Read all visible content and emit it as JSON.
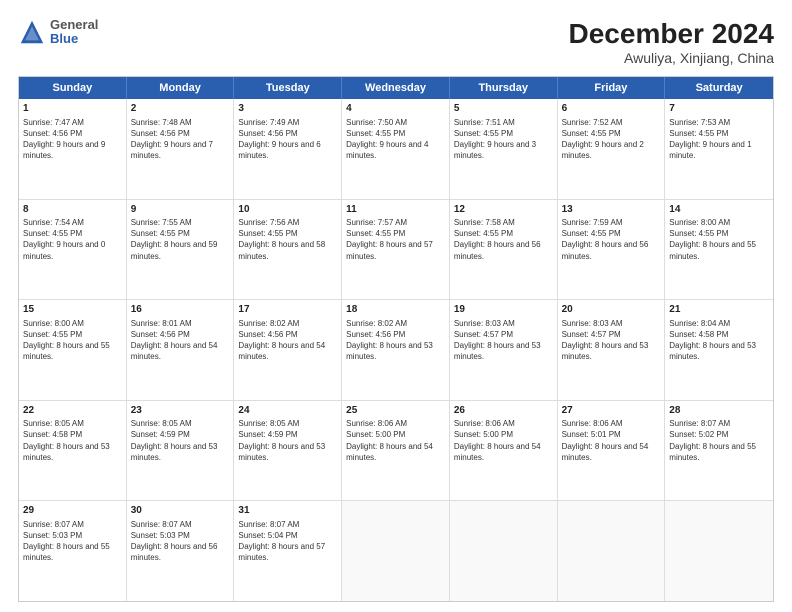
{
  "header": {
    "logo_general": "General",
    "logo_blue": "Blue",
    "title": "December 2024",
    "subtitle": "Awuliya, Xinjiang, China"
  },
  "weekdays": [
    "Sunday",
    "Monday",
    "Tuesday",
    "Wednesday",
    "Thursday",
    "Friday",
    "Saturday"
  ],
  "weeks": [
    [
      {
        "day": "1",
        "sunrise": "Sunrise: 7:47 AM",
        "sunset": "Sunset: 4:56 PM",
        "daylight": "Daylight: 9 hours and 9 minutes."
      },
      {
        "day": "2",
        "sunrise": "Sunrise: 7:48 AM",
        "sunset": "Sunset: 4:56 PM",
        "daylight": "Daylight: 9 hours and 7 minutes."
      },
      {
        "day": "3",
        "sunrise": "Sunrise: 7:49 AM",
        "sunset": "Sunset: 4:56 PM",
        "daylight": "Daylight: 9 hours and 6 minutes."
      },
      {
        "day": "4",
        "sunrise": "Sunrise: 7:50 AM",
        "sunset": "Sunset: 4:55 PM",
        "daylight": "Daylight: 9 hours and 4 minutes."
      },
      {
        "day": "5",
        "sunrise": "Sunrise: 7:51 AM",
        "sunset": "Sunset: 4:55 PM",
        "daylight": "Daylight: 9 hours and 3 minutes."
      },
      {
        "day": "6",
        "sunrise": "Sunrise: 7:52 AM",
        "sunset": "Sunset: 4:55 PM",
        "daylight": "Daylight: 9 hours and 2 minutes."
      },
      {
        "day": "7",
        "sunrise": "Sunrise: 7:53 AM",
        "sunset": "Sunset: 4:55 PM",
        "daylight": "Daylight: 9 hours and 1 minute."
      }
    ],
    [
      {
        "day": "8",
        "sunrise": "Sunrise: 7:54 AM",
        "sunset": "Sunset: 4:55 PM",
        "daylight": "Daylight: 9 hours and 0 minutes."
      },
      {
        "day": "9",
        "sunrise": "Sunrise: 7:55 AM",
        "sunset": "Sunset: 4:55 PM",
        "daylight": "Daylight: 8 hours and 59 minutes."
      },
      {
        "day": "10",
        "sunrise": "Sunrise: 7:56 AM",
        "sunset": "Sunset: 4:55 PM",
        "daylight": "Daylight: 8 hours and 58 minutes."
      },
      {
        "day": "11",
        "sunrise": "Sunrise: 7:57 AM",
        "sunset": "Sunset: 4:55 PM",
        "daylight": "Daylight: 8 hours and 57 minutes."
      },
      {
        "day": "12",
        "sunrise": "Sunrise: 7:58 AM",
        "sunset": "Sunset: 4:55 PM",
        "daylight": "Daylight: 8 hours and 56 minutes."
      },
      {
        "day": "13",
        "sunrise": "Sunrise: 7:59 AM",
        "sunset": "Sunset: 4:55 PM",
        "daylight": "Daylight: 8 hours and 56 minutes."
      },
      {
        "day": "14",
        "sunrise": "Sunrise: 8:00 AM",
        "sunset": "Sunset: 4:55 PM",
        "daylight": "Daylight: 8 hours and 55 minutes."
      }
    ],
    [
      {
        "day": "15",
        "sunrise": "Sunrise: 8:00 AM",
        "sunset": "Sunset: 4:55 PM",
        "daylight": "Daylight: 8 hours and 55 minutes."
      },
      {
        "day": "16",
        "sunrise": "Sunrise: 8:01 AM",
        "sunset": "Sunset: 4:56 PM",
        "daylight": "Daylight: 8 hours and 54 minutes."
      },
      {
        "day": "17",
        "sunrise": "Sunrise: 8:02 AM",
        "sunset": "Sunset: 4:56 PM",
        "daylight": "Daylight: 8 hours and 54 minutes."
      },
      {
        "day": "18",
        "sunrise": "Sunrise: 8:02 AM",
        "sunset": "Sunset: 4:56 PM",
        "daylight": "Daylight: 8 hours and 53 minutes."
      },
      {
        "day": "19",
        "sunrise": "Sunrise: 8:03 AM",
        "sunset": "Sunset: 4:57 PM",
        "daylight": "Daylight: 8 hours and 53 minutes."
      },
      {
        "day": "20",
        "sunrise": "Sunrise: 8:03 AM",
        "sunset": "Sunset: 4:57 PM",
        "daylight": "Daylight: 8 hours and 53 minutes."
      },
      {
        "day": "21",
        "sunrise": "Sunrise: 8:04 AM",
        "sunset": "Sunset: 4:58 PM",
        "daylight": "Daylight: 8 hours and 53 minutes."
      }
    ],
    [
      {
        "day": "22",
        "sunrise": "Sunrise: 8:05 AM",
        "sunset": "Sunset: 4:58 PM",
        "daylight": "Daylight: 8 hours and 53 minutes."
      },
      {
        "day": "23",
        "sunrise": "Sunrise: 8:05 AM",
        "sunset": "Sunset: 4:59 PM",
        "daylight": "Daylight: 8 hours and 53 minutes."
      },
      {
        "day": "24",
        "sunrise": "Sunrise: 8:05 AM",
        "sunset": "Sunset: 4:59 PM",
        "daylight": "Daylight: 8 hours and 53 minutes."
      },
      {
        "day": "25",
        "sunrise": "Sunrise: 8:06 AM",
        "sunset": "Sunset: 5:00 PM",
        "daylight": "Daylight: 8 hours and 54 minutes."
      },
      {
        "day": "26",
        "sunrise": "Sunrise: 8:06 AM",
        "sunset": "Sunset: 5:00 PM",
        "daylight": "Daylight: 8 hours and 54 minutes."
      },
      {
        "day": "27",
        "sunrise": "Sunrise: 8:06 AM",
        "sunset": "Sunset: 5:01 PM",
        "daylight": "Daylight: 8 hours and 54 minutes."
      },
      {
        "day": "28",
        "sunrise": "Sunrise: 8:07 AM",
        "sunset": "Sunset: 5:02 PM",
        "daylight": "Daylight: 8 hours and 55 minutes."
      }
    ],
    [
      {
        "day": "29",
        "sunrise": "Sunrise: 8:07 AM",
        "sunset": "Sunset: 5:03 PM",
        "daylight": "Daylight: 8 hours and 55 minutes."
      },
      {
        "day": "30",
        "sunrise": "Sunrise: 8:07 AM",
        "sunset": "Sunset: 5:03 PM",
        "daylight": "Daylight: 8 hours and 56 minutes."
      },
      {
        "day": "31",
        "sunrise": "Sunrise: 8:07 AM",
        "sunset": "Sunset: 5:04 PM",
        "daylight": "Daylight: 8 hours and 57 minutes."
      },
      null,
      null,
      null,
      null
    ]
  ]
}
